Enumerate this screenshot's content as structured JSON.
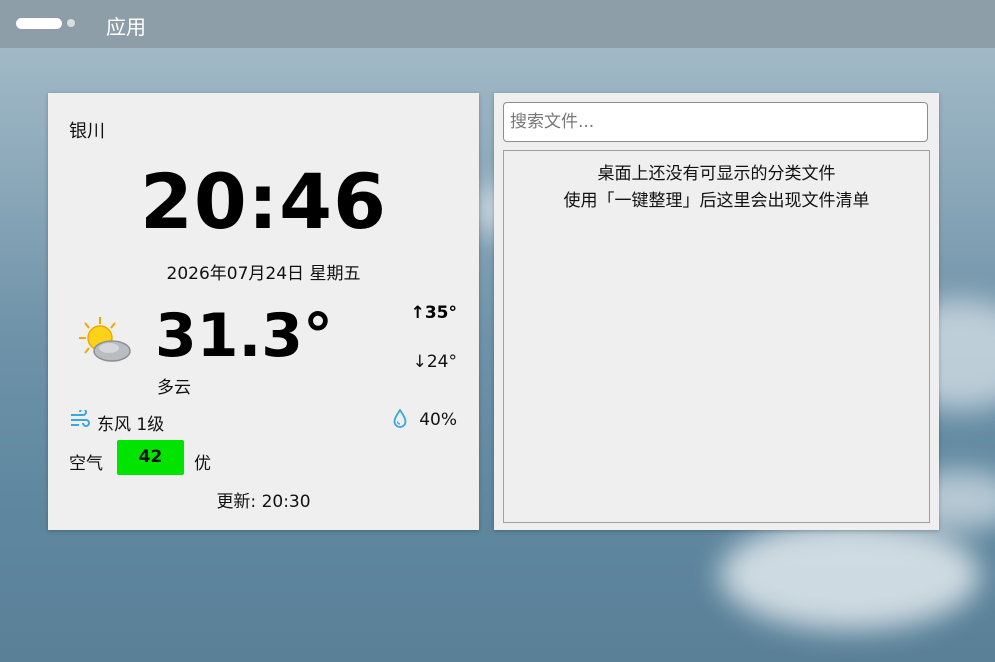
{
  "topbar": {
    "title": "应用"
  },
  "weather": {
    "city": "银川",
    "time": "20:46",
    "date": "2026年07月24日 星期五",
    "icon": "partly-cloudy-icon",
    "temperature": "31.3°",
    "condition": "多云",
    "high": "35°",
    "low": "24°",
    "wind": "东风 1级",
    "humidity": "40%",
    "air_quality_label": "空气",
    "aqi": "42",
    "aqi_level": "优",
    "aqi_color": "#00e400",
    "updated": "更新: 20:30"
  },
  "files": {
    "search_placeholder": "搜索文件...",
    "empty_line1": "桌面上还没有可显示的分类文件",
    "empty_line2": "使用「一键整理」后这里会出现文件清单"
  },
  "colors": {
    "topbar": "#8e9ea8",
    "panel": "#efefef",
    "accent_icon": "#3aa7e0"
  }
}
